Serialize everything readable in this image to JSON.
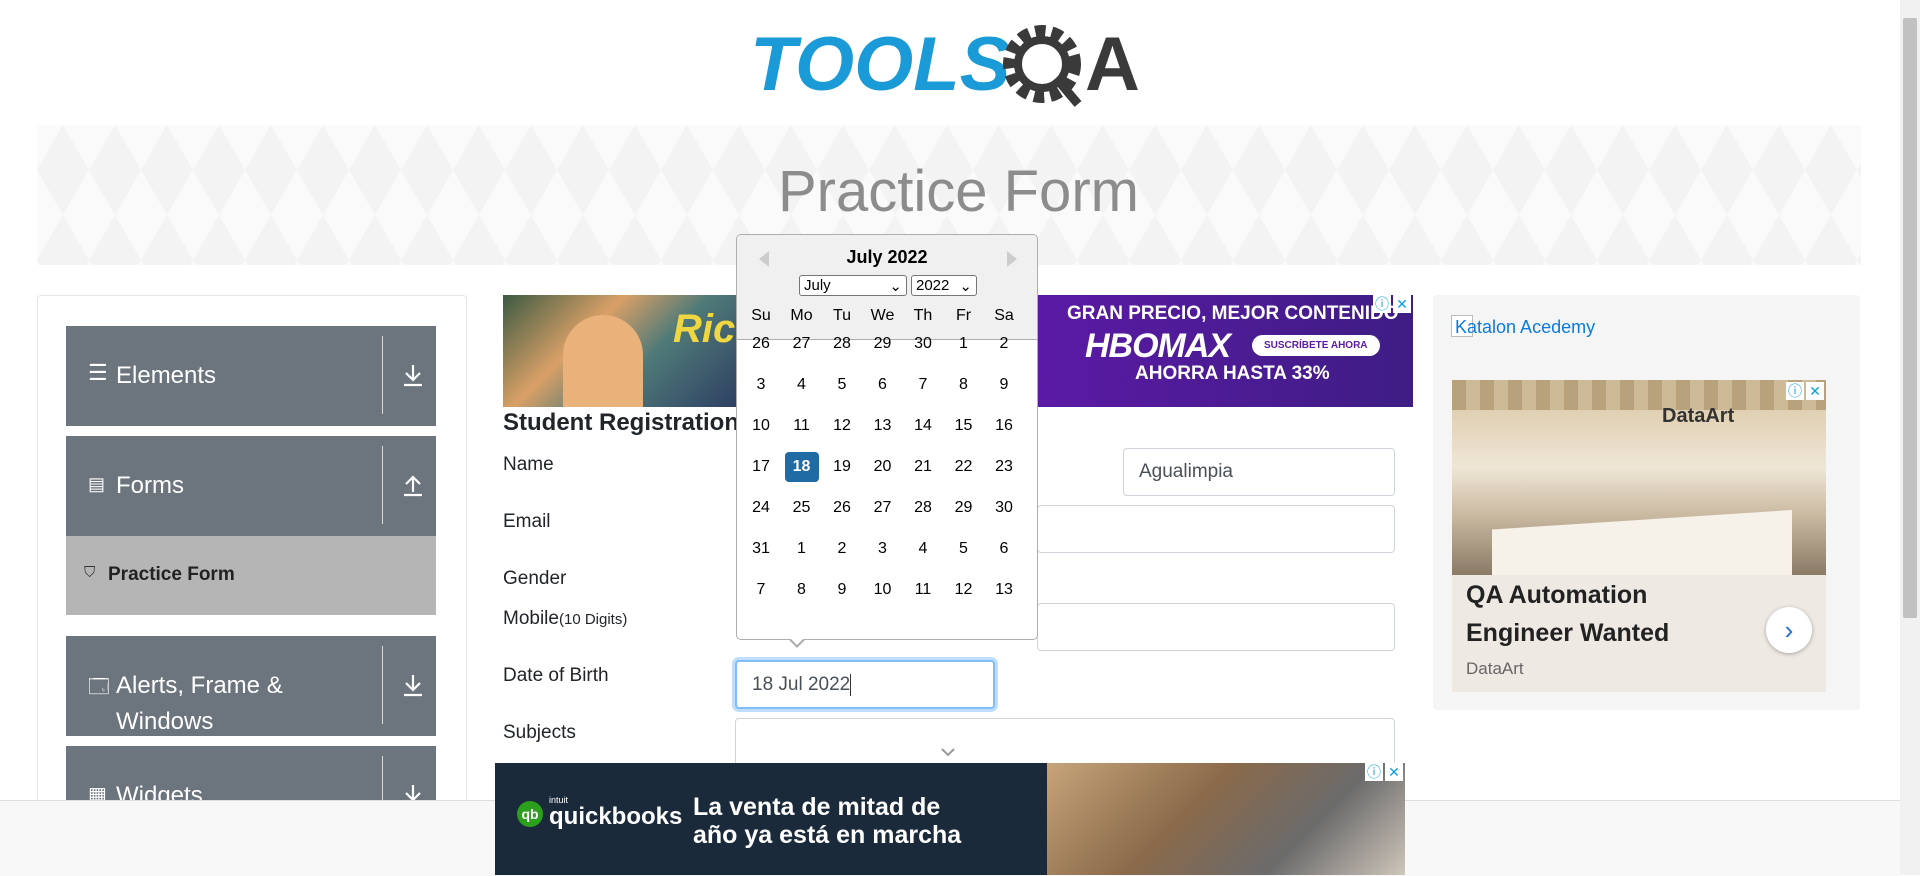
{
  "header": {
    "logo_text": "TOOLSQA",
    "logo_tools": "TOOLS",
    "logo_a": "A",
    "page_title": "Practice Form"
  },
  "sidebar": {
    "groups": [
      {
        "label": "Elements",
        "icon": "hamburger-icon",
        "arrow": "download-icon"
      },
      {
        "label": "Forms",
        "icon": "document-icon",
        "arrow": "upload-icon"
      },
      {
        "label_line1": "Alerts, Frame &",
        "label_line2": "Windows",
        "icon": "window-icon",
        "arrow": "download-icon"
      },
      {
        "label": "Widgets",
        "icon": "widgets-icon",
        "arrow": "download-icon"
      }
    ],
    "active_item": {
      "label": "Practice Form",
      "icon": "html5-icon"
    }
  },
  "form": {
    "heading": "Student Registration",
    "labels": {
      "name": "Name",
      "email": "Email",
      "gender": "Gender",
      "mobile": "Mobile",
      "mobile_hint": "(10 Digits)",
      "dob": "Date of Birth",
      "subjects": "Subjects"
    },
    "last_name_value": "Agualimpia",
    "dob_value": "18 Jul 2022"
  },
  "datepicker": {
    "month_title": "July 2022",
    "month_select": "July",
    "year_select": "2022",
    "weekdays": [
      "Su",
      "Mo",
      "Tu",
      "We",
      "Th",
      "Fr",
      "Sa"
    ],
    "weeks": [
      [
        "26",
        "27",
        "28",
        "29",
        "30",
        "1",
        "2"
      ],
      [
        "3",
        "4",
        "5",
        "6",
        "7",
        "8",
        "9"
      ],
      [
        "10",
        "11",
        "12",
        "13",
        "14",
        "15",
        "16"
      ],
      [
        "17",
        "18",
        "19",
        "20",
        "21",
        "22",
        "23"
      ],
      [
        "24",
        "25",
        "26",
        "27",
        "28",
        "29",
        "30"
      ],
      [
        "31",
        "1",
        "2",
        "3",
        "4",
        "5",
        "6"
      ],
      [
        "7",
        "8",
        "9",
        "10",
        "11",
        "12",
        "13"
      ]
    ],
    "selected": "18",
    "accent": "#216ba5"
  },
  "ads": {
    "top_right": {
      "line1": "GRAN PRECIO, MEJOR CONTENIDO",
      "brand": "HBOMAX",
      "cta": "SUSCRÍBETE AHORA",
      "line2": "AHORRA HASTA 33%"
    },
    "top_left": {
      "text": "Rick"
    },
    "right": {
      "alt_link": "Katalon Acedemy",
      "photo_brand": "DataArt",
      "title_line1": "QA Automation",
      "title_line2": "Engineer Wanted",
      "company": "DataArt"
    },
    "bottom": {
      "brand_small": "intuit",
      "brand": "quickbooks",
      "line1": "La venta de mitad de",
      "line2": "año ya está en marcha"
    }
  },
  "colors": {
    "primary": "#6c757d",
    "active_bg": "#b5b5b5",
    "logo_blue": "#1a9ad6",
    "logo_dark": "#3a3a3a",
    "focus": "#80bdff"
  }
}
